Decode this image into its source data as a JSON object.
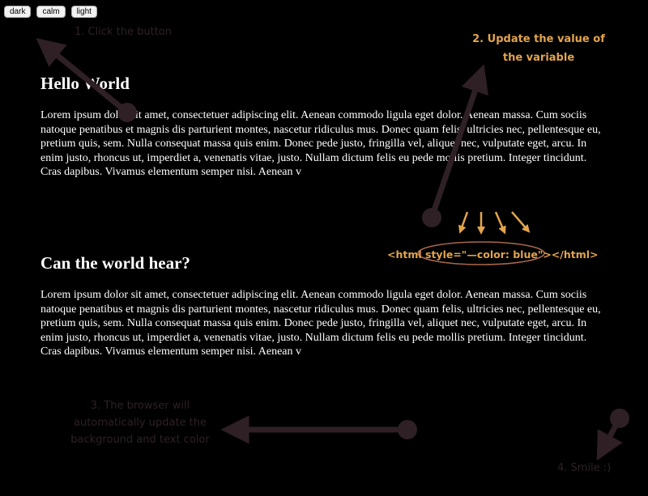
{
  "theme_buttons": [
    "dark",
    "calm",
    "light"
  ],
  "sections": [
    {
      "title": "Hello World",
      "body": "Lorem ipsum dolor sit amet, consectetuer adipiscing elit. Aenean commodo ligula eget dolor. Aenean massa. Cum sociis natoque penatibus et magnis dis parturient montes, nascetur ridiculus mus. Donec quam felis, ultricies nec, pellentesque eu, pretium quis, sem. Nulla consequat massa quis enim. Donec pede justo, fringilla vel, aliquet nec, vulputate eget, arcu. In enim justo, rhoncus ut, imperdiet a, venenatis vitae, justo. Nullam dictum felis eu pede mollis pretium. Integer tincidunt. Cras dapibus. Vivamus elementum semper nisi. Aenean v"
    },
    {
      "title": "Can the world hear?",
      "body": "Lorem ipsum dolor sit amet, consectetuer adipiscing elit. Aenean commodo ligula eget dolor. Aenean massa. Cum sociis natoque penatibus et magnis dis parturient montes, nascetur ridiculus mus. Donec quam felis, ultricies nec, pellentesque eu, pretium quis, sem. Nulla consequat massa quis enim. Donec pede justo, fringilla vel, aliquet nec, vulputate eget, arcu. In enim justo, rhoncus ut, imperdiet a, venenatis vitae, justo. Nullam dictum felis eu pede mollis pretium. Integer tincidunt. Cras dapibus. Vivamus elementum semper nisi. Aenean v"
    }
  ],
  "annotations": {
    "step1": "1. Click the button",
    "step2": "2. Update the value of the variable",
    "step3": "3. The browser will automatically update the background and text color",
    "step4": "4. Smile :)",
    "code": "<html style=\"—color: blue\"></html>"
  },
  "colors": {
    "background": "#000000",
    "text": "#ffffff",
    "annotation_dim": "#2e2025",
    "annotation_accent": "#e2a44e"
  }
}
